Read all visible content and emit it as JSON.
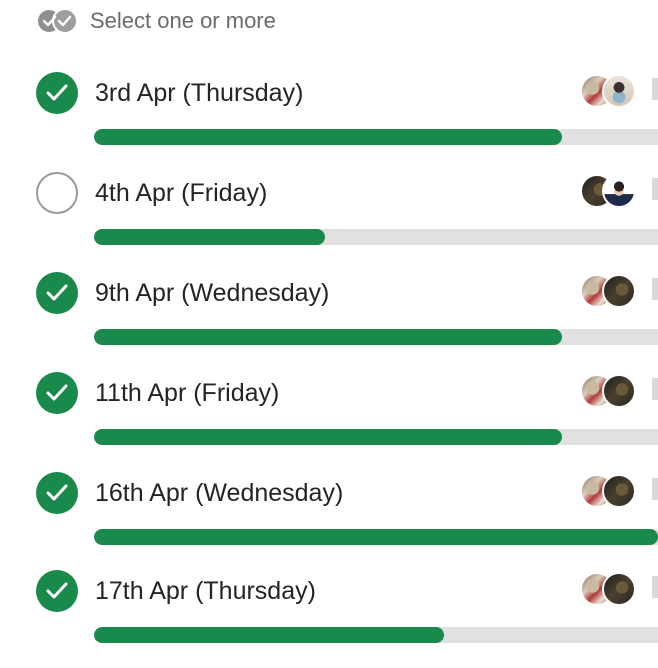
{
  "poll": {
    "hint": "Select one or more",
    "options": [
      {
        "label": "3rd Apr (Thursday)",
        "selected": true,
        "vote_fraction": 0.83,
        "avatars": [
          "photo-avatar-flag",
          "photo-avatar-masked"
        ]
      },
      {
        "label": "4th Apr (Friday)",
        "selected": false,
        "vote_fraction": 0.41,
        "avatars": [
          "photo-avatar-dark",
          "photo-avatar-suit"
        ]
      },
      {
        "label": "9th Apr (Wednesday)",
        "selected": true,
        "vote_fraction": 0.83,
        "avatars": [
          "photo-avatar-flag",
          "photo-avatar-dark"
        ]
      },
      {
        "label": "11th Apr (Friday)",
        "selected": true,
        "vote_fraction": 0.83,
        "avatars": [
          "photo-avatar-flag",
          "photo-avatar-dark"
        ]
      },
      {
        "label": "16th Apr (Wednesday)",
        "selected": true,
        "vote_fraction": 1.0,
        "avatars": [
          "photo-avatar-flag",
          "photo-avatar-dark"
        ]
      },
      {
        "label": "17th Apr (Thursday)",
        "selected": true,
        "vote_fraction": 0.62,
        "avatars": [
          "photo-avatar-flag",
          "photo-avatar-dark"
        ]
      }
    ]
  },
  "colors": {
    "accent": "#1a8a4c",
    "track": "#e1e1e1",
    "text": "#242424",
    "hint": "#6b6b6b"
  }
}
